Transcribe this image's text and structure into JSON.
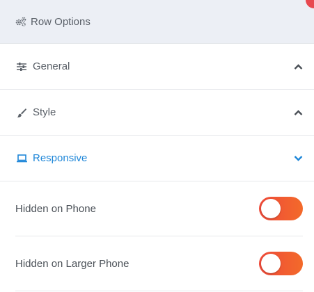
{
  "header": {
    "title": "Row Options",
    "icon": "gears-icon"
  },
  "sections": [
    {
      "label": "General",
      "icon": "sliders-icon",
      "expanded": false
    },
    {
      "label": "Style",
      "icon": "paintbrush-icon",
      "expanded": false
    },
    {
      "label": "Responsive",
      "icon": "laptop-icon",
      "expanded": true
    }
  ],
  "responsive": {
    "options": [
      {
        "label": "Hidden on Phone",
        "enabled": true
      },
      {
        "label": "Hidden on Larger Phone",
        "enabled": true
      }
    ]
  },
  "colors": {
    "accent": "#1e86d8",
    "toggle_start": "#ef4a3a",
    "toggle_end": "#f36a2a",
    "header_bg": "#eceff5",
    "close_badge": "#e8484f"
  }
}
